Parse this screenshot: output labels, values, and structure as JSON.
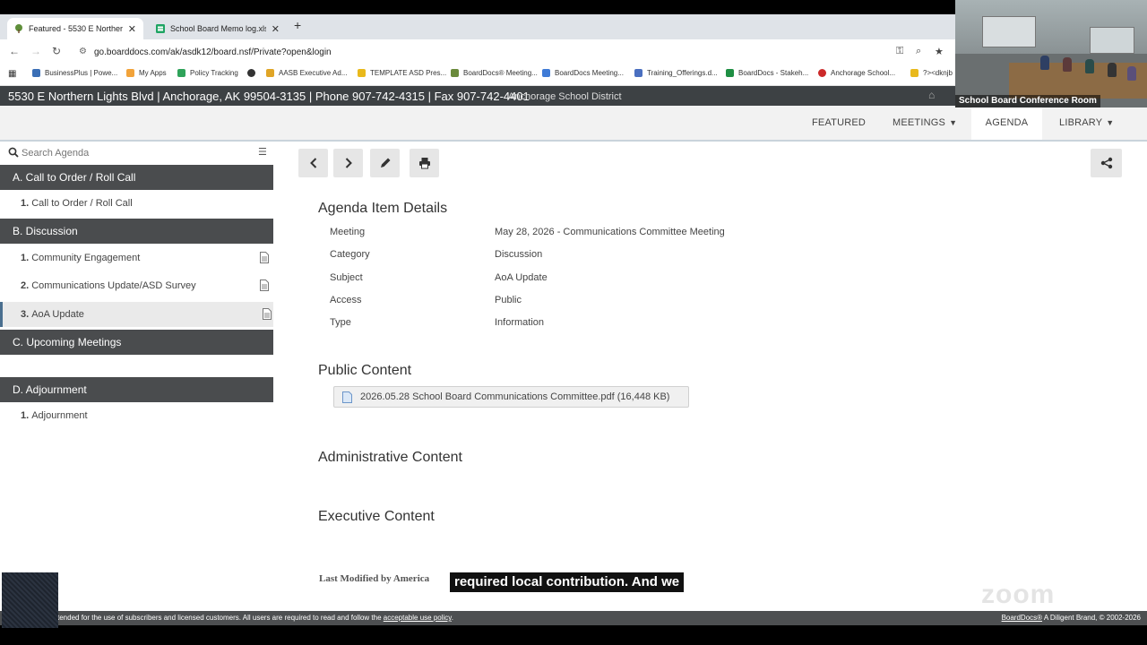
{
  "browser": {
    "tabs": [
      {
        "title": "Featured - 5530 E Northern Lights",
        "close": "✕"
      },
      {
        "title": "School Board Memo log.xlsx - ",
        "close": "✕"
      }
    ],
    "new_tab": "+",
    "url": "go.boarddocs.com/ak/asdk12/board.nsf/Private?open&login",
    "bookmarks": [
      {
        "label": "BusinessPlus | Powe...",
        "color": "#3b6fb6"
      },
      {
        "label": "My Apps",
        "color": "#f2a33a"
      },
      {
        "label": "Policy Tracking",
        "color": "#2fa35a"
      },
      {
        "label": "",
        "color": "#333333"
      },
      {
        "label": "AASB Executive Ad...",
        "color": "#e0a526"
      },
      {
        "label": "TEMPLATE ASD Pres...",
        "color": "#e9b91c"
      },
      {
        "label": "BoardDocs® Meeting...",
        "color": "#6a8a3b"
      },
      {
        "label": "BoardDocs Meeting...",
        "color": "#3f7bd6"
      },
      {
        "label": "Training_Offerings.d...",
        "color": "#4a6fc0"
      },
      {
        "label": "BoardDocs - Stakeh...",
        "color": "#1f8f43"
      },
      {
        "label": "Anchorage School...",
        "color": "#cc2a2a"
      },
      {
        "label": "?><dknjb",
        "color": "#e9b91c"
      }
    ]
  },
  "org": {
    "address": "5530 E Northern Lights Blvd | Anchorage, AK 99504-3135 | Phone 907-742-4315 | Fax 907-742-4401",
    "name": "Anchorage School District"
  },
  "nav": {
    "featured": "FEATURED",
    "meetings": "MEETINGS",
    "agenda": "AGENDA",
    "library": "LIBRARY"
  },
  "sidebar": {
    "search_placeholder": "Search Agenda",
    "categories": [
      {
        "label": "A. Call to Order / Roll Call"
      },
      {
        "label": "B. Discussion"
      },
      {
        "label": "C. Upcoming Meetings"
      },
      {
        "label": "D. Adjournment"
      }
    ],
    "items": [
      {
        "num": "1.",
        "label": "Call to Order / Roll Call"
      },
      {
        "num": "1.",
        "label": "Community Engagement"
      },
      {
        "num": "2.",
        "label": "Communications Update/ASD Survey"
      },
      {
        "num": "3.",
        "label": "AoA Update"
      },
      {
        "num": "1.",
        "label": "Adjournment"
      }
    ]
  },
  "details": {
    "heading": "Agenda Item Details",
    "rows": [
      {
        "key": "Meeting",
        "value": "May 28, 2026 - Communications Committee Meeting"
      },
      {
        "key": "Category",
        "value": "Discussion"
      },
      {
        "key": "Subject",
        "value": "AoA Update"
      },
      {
        "key": "Access",
        "value": "Public"
      },
      {
        "key": "Type",
        "value": "Information"
      }
    ],
    "public_heading": "Public Content",
    "file": "2026.05.28 School Board Communications Committee.pdf (16,448 KB)",
    "admin_heading": "Administrative Content",
    "exec_heading": "Executive Content",
    "last_modified": "Last Modified by America"
  },
  "footer": {
    "left_text": "tended for the use of subscribers and licensed customers. All users are required to read and follow the",
    "left_link": "acceptable use policy",
    "left_end": ".",
    "right_link": "BoardDocs®",
    "right_text": " A Diligent Brand, © 2002-2026"
  },
  "overlay": {
    "caption": "required local contribution. And we",
    "video_label": "School Board Conference Room",
    "watermark": "zoom"
  }
}
